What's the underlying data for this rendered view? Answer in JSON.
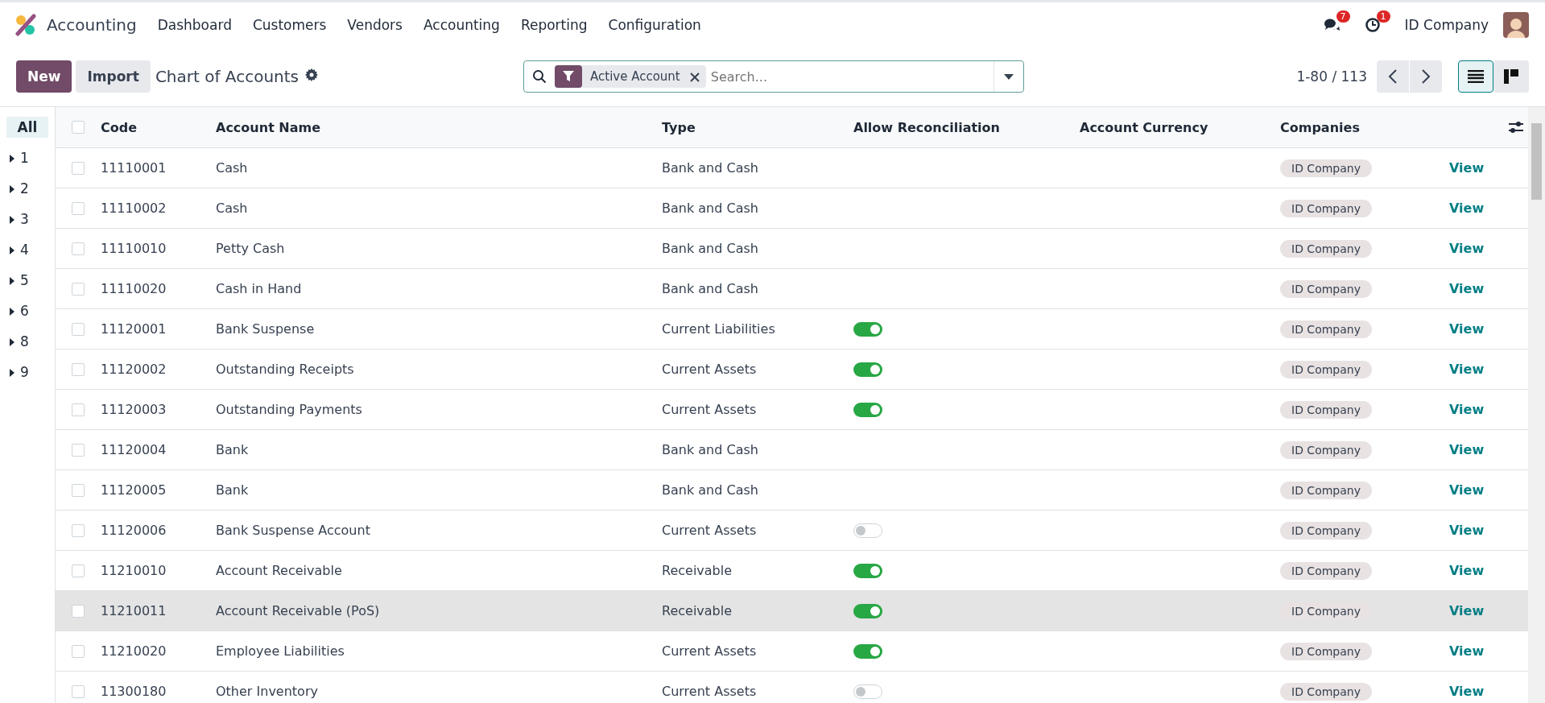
{
  "navbar": {
    "app_name": "Accounting",
    "menu": [
      "Dashboard",
      "Customers",
      "Vendors",
      "Accounting",
      "Reporting",
      "Configuration"
    ],
    "messages_count": "7",
    "activities_count": "1",
    "company": "ID Company"
  },
  "control_panel": {
    "new_button": "New",
    "import_button": "Import",
    "title": "Chart of Accounts",
    "filter_facet": "Active Account",
    "search": {
      "placeholder": "Search..."
    },
    "pager": "1-80 / 113",
    "views": [
      {
        "kind": "list",
        "selected": true
      },
      {
        "kind": "kanban",
        "selected": false
      }
    ]
  },
  "sidebar": {
    "items": [
      {
        "label": "All",
        "selected": true,
        "expandable": false
      },
      {
        "label": "1",
        "selected": false,
        "expandable": true
      },
      {
        "label": "2",
        "selected": false,
        "expandable": true
      },
      {
        "label": "3",
        "selected": false,
        "expandable": true
      },
      {
        "label": "4",
        "selected": false,
        "expandable": true
      },
      {
        "label": "5",
        "selected": false,
        "expandable": true
      },
      {
        "label": "6",
        "selected": false,
        "expandable": true
      },
      {
        "label": "8",
        "selected": false,
        "expandable": true
      },
      {
        "label": "9",
        "selected": false,
        "expandable": true
      }
    ]
  },
  "table": {
    "select_all_checked": false,
    "columns": [
      "Code",
      "Account Name",
      "Type",
      "Allow Reconciliation",
      "Account Currency",
      "Companies"
    ],
    "rows": [
      {
        "code": "11110001",
        "name": "Cash",
        "type": "Bank and Cash",
        "company": "ID Company",
        "action": "View",
        "hovered": false,
        "checked": false
      },
      {
        "code": "11110002",
        "name": "Cash",
        "type": "Bank and Cash",
        "company": "ID Company",
        "action": "View",
        "hovered": false,
        "checked": false
      },
      {
        "code": "11110010",
        "name": "Petty Cash",
        "type": "Bank and Cash",
        "company": "ID Company",
        "action": "View",
        "hovered": false,
        "checked": false
      },
      {
        "code": "11110020",
        "name": "Cash in Hand",
        "type": "Bank and Cash",
        "company": "ID Company",
        "action": "View",
        "hovered": false,
        "checked": false
      },
      {
        "code": "11120001",
        "name": "Bank Suspense",
        "type": "Current Liabilities",
        "allow_reconciliation": true,
        "company": "ID Company",
        "action": "View",
        "hovered": false,
        "checked": false
      },
      {
        "code": "11120002",
        "name": "Outstanding Receipts",
        "type": "Current Assets",
        "allow_reconciliation": true,
        "company": "ID Company",
        "action": "View",
        "hovered": false,
        "checked": false
      },
      {
        "code": "11120003",
        "name": "Outstanding Payments",
        "type": "Current Assets",
        "allow_reconciliation": true,
        "company": "ID Company",
        "action": "View",
        "hovered": false,
        "checked": false
      },
      {
        "code": "11120004",
        "name": "Bank",
        "type": "Bank and Cash",
        "company": "ID Company",
        "action": "View",
        "hovered": false,
        "checked": false
      },
      {
        "code": "11120005",
        "name": "Bank",
        "type": "Bank and Cash",
        "company": "ID Company",
        "action": "View",
        "hovered": false,
        "checked": false
      },
      {
        "code": "11120006",
        "name": "Bank Suspense Account",
        "type": "Current Assets",
        "allow_reconciliation": false,
        "company": "ID Company",
        "action": "View",
        "hovered": false,
        "checked": false
      },
      {
        "code": "11210010",
        "name": "Account Receivable",
        "type": "Receivable",
        "allow_reconciliation": true,
        "company": "ID Company",
        "action": "View",
        "hovered": false,
        "checked": false
      },
      {
        "code": "11210011",
        "name": "Account Receivable (PoS)",
        "type": "Receivable",
        "allow_reconciliation": true,
        "company": "ID Company",
        "action": "View",
        "hovered": true,
        "checked": false
      },
      {
        "code": "11210020",
        "name": "Employee Liabilities",
        "type": "Current Assets",
        "allow_reconciliation": true,
        "company": "ID Company",
        "action": "View",
        "hovered": false,
        "checked": false
      },
      {
        "code": "11300180",
        "name": "Other Inventory",
        "type": "Current Assets",
        "allow_reconciliation": false,
        "company": "ID Company",
        "action": "View",
        "hovered": false,
        "checked": false
      }
    ]
  }
}
